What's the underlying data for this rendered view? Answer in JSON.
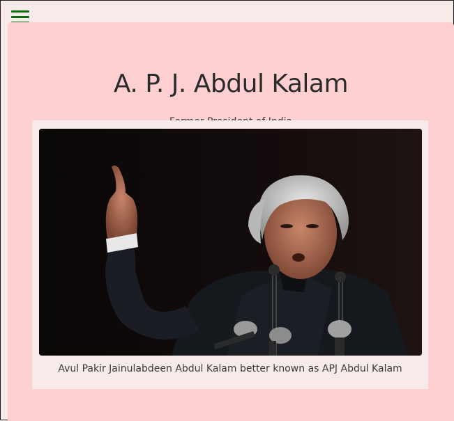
{
  "menu": {
    "icon": "hamburger-menu-icon",
    "color": "#0f6b0f"
  },
  "profile": {
    "name": "A. P. J. Abdul Kalam",
    "role": "Former President of India",
    "caption": "Avul Pakir Jainulabdeen Abdul Kalam better known as APJ Abdul Kalam"
  },
  "colors": {
    "page_background": "#f7ebea",
    "card_background": "#ffd0d2",
    "figure_background": "#f7ebea",
    "text": "#2b2b2b"
  }
}
